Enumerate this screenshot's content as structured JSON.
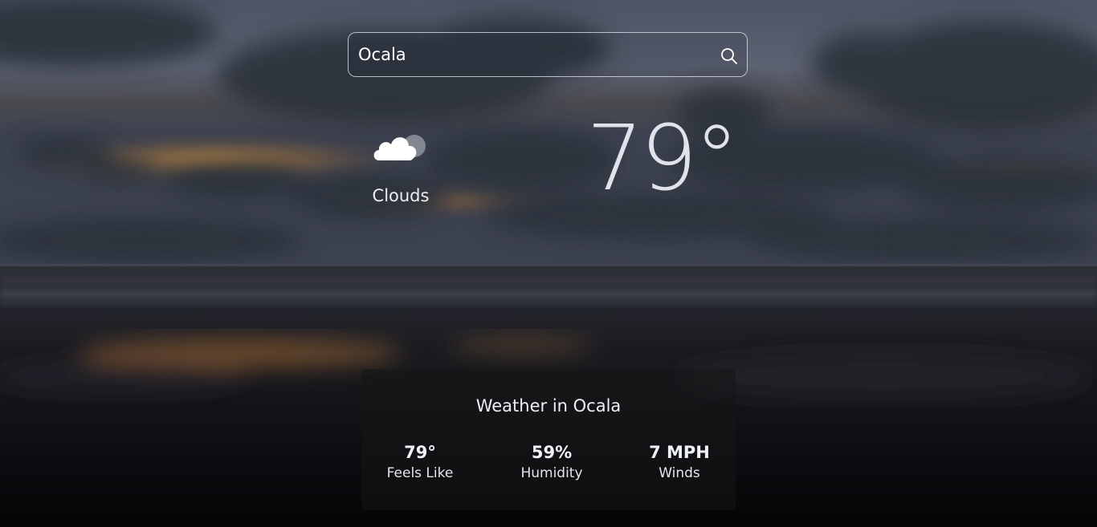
{
  "search": {
    "value": "Ocala",
    "icon": "search-icon"
  },
  "current": {
    "condition": "Clouds",
    "condition_icon": "cloud-icon",
    "temperature": "79°"
  },
  "details": {
    "title": "Weather in Ocala",
    "stats": [
      {
        "value": "79°",
        "label": "Feels Like"
      },
      {
        "value": "59%",
        "label": "Humidity"
      },
      {
        "value": "7 MPH",
        "label": "Winds"
      }
    ]
  },
  "colors": {
    "sky_top": "#4f5566",
    "sunset_glow": "#c98a3a",
    "sea": "#2b2f38",
    "ground": "#07080b"
  }
}
